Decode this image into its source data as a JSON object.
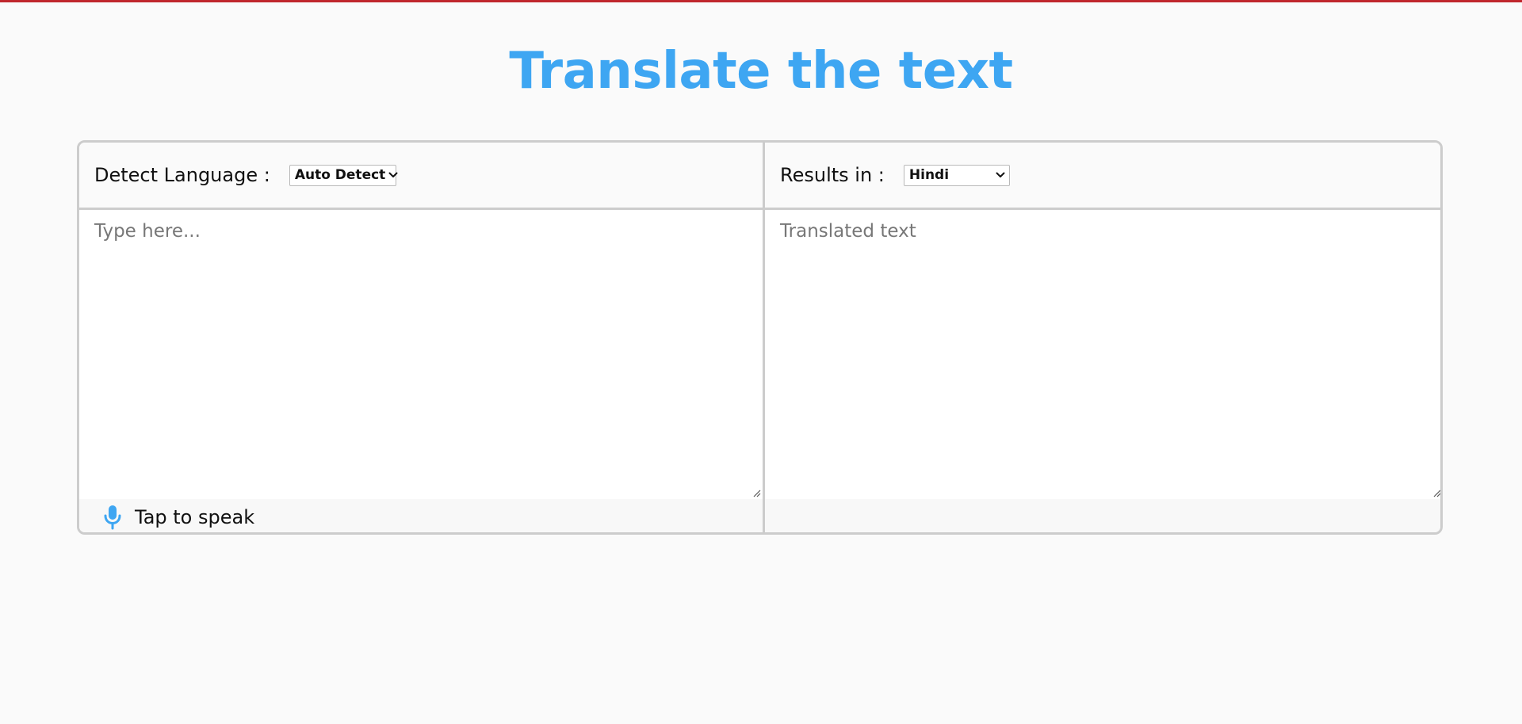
{
  "theme": {
    "accent": "#3ea6f2",
    "top_border": "#c0272d",
    "border": "#cccccc"
  },
  "page": {
    "title": "Translate the text"
  },
  "source": {
    "label": "Detect Language :",
    "selected_language": "Auto Detect",
    "placeholder": "Type here...",
    "mic_icon": "microphone-icon",
    "mic_label": "Tap to speak"
  },
  "target": {
    "label": "Results in :",
    "selected_language": "Hindi",
    "placeholder": "Translated text"
  }
}
